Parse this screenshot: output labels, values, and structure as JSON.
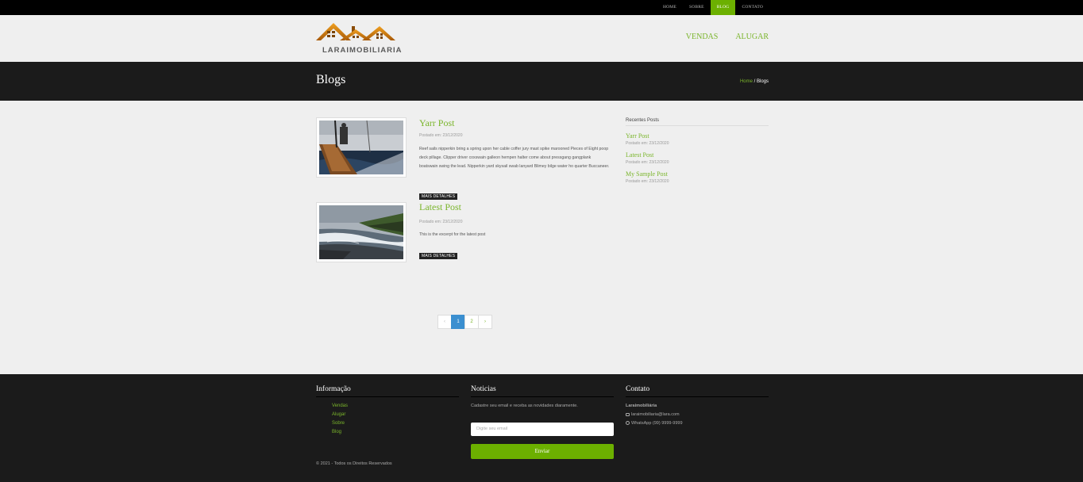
{
  "topnav": [
    {
      "label": "HOME",
      "active": false
    },
    {
      "label": "SOBRE",
      "active": false
    },
    {
      "label": "BLOG",
      "active": true
    },
    {
      "label": "CONTATO",
      "active": false
    }
  ],
  "header": {
    "logo_text": "LARAIMOBILIARIA",
    "nav": [
      "VENDAS",
      "ALUGAR"
    ]
  },
  "band": {
    "title": "Blogs",
    "breadcrumb_home": "Home",
    "breadcrumb_sep": " / ",
    "breadcrumb_current": "Blogs"
  },
  "posts": [
    {
      "title": "Yarr Post",
      "date": "Postado em: 23/12/2020",
      "excerpt": "Reef sails nipperkin bring a spring upon her cable coffer jury mast spike marooned Pieces of Eight poop deck pillage. Clipper driver coxswain galleon hempen halter come about pressgang gangplank boatswain swing the lead. Nipperkin yard skysail swab lanyard Blimey bilge water ho quarter Buccaneer.",
      "more": "MAIS DETALHES",
      "image": "sailboat-photo"
    },
    {
      "title": "Latest Post",
      "date": "Postado em: 23/12/2020",
      "excerpt": "This is the excerpt for the latest post",
      "more": "MAIS DETALHES",
      "image": "coast-waves-photo"
    }
  ],
  "pagination": {
    "prev": "‹",
    "pages": [
      "1",
      "2"
    ],
    "active": "1",
    "next": "›"
  },
  "sidebar": {
    "heading": "Recentes Posts",
    "items": [
      {
        "title": "Yarr Post",
        "date": "Postado em: 23/12/2020"
      },
      {
        "title": "Latest Post",
        "date": "Postado em: 23/12/2020"
      },
      {
        "title": "My Sample Post",
        "date": "Postado em: 23/12/2020"
      }
    ]
  },
  "footer": {
    "info": {
      "heading": "Informação",
      "links": [
        "Vendas",
        "Alugar",
        "Sobre",
        "Blog"
      ]
    },
    "news": {
      "heading": "Noticias",
      "text": "Cadastre seu email e receba as novidades diaramente.",
      "placeholder": "Digite seu email",
      "button": "Enviar"
    },
    "contact": {
      "heading": "Contato",
      "company": "Laraimobiliária",
      "email": "laraimobiliaria@lara.com",
      "whatsapp": "WhatsApp (99) 9999-9999"
    },
    "copyright": "© 2021 - Todos os Direitos Reservados"
  },
  "colors": {
    "accent": "#6cb000",
    "link_green": "#7ab52b",
    "dark": "#1b1b1b",
    "page_active": "#3b8fd0"
  }
}
